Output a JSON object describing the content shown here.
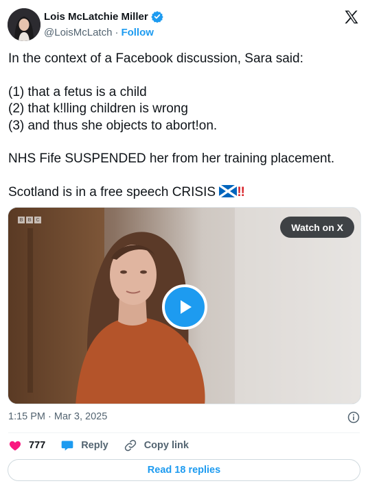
{
  "author": {
    "display_name": "Lois McLatchie Miller",
    "handle": "@LoisMcLatch",
    "separator": "·",
    "follow_label": "Follow",
    "verified": true
  },
  "tweet": {
    "line1": "In the context of a Facebook discussion, Sara said:",
    "point1": "(1) that a fetus is a child",
    "point2": "(2) that k!lling children is wrong",
    "point3": "(3) and thus she objects to abort!on.",
    "line2": "NHS Fife SUSPENDED her from her training placement.",
    "line3": "Scotland is in a free speech CRISIS",
    "emoji_flag": "scotland-flag",
    "emoji_bang": "‼"
  },
  "media": {
    "watermark": [
      "B",
      "B",
      "C"
    ],
    "watch_label": "Watch on X"
  },
  "meta": {
    "timestamp": "1:15 PM · Mar 3, 2025"
  },
  "actions": {
    "like_count": "777",
    "reply_label": "Reply",
    "copy_label": "Copy link"
  },
  "read_replies_label": "Read 18 replies",
  "colors": {
    "accent": "#1d9bf0",
    "like": "#f91880",
    "text": "#0f1419",
    "secondary": "#536471"
  }
}
